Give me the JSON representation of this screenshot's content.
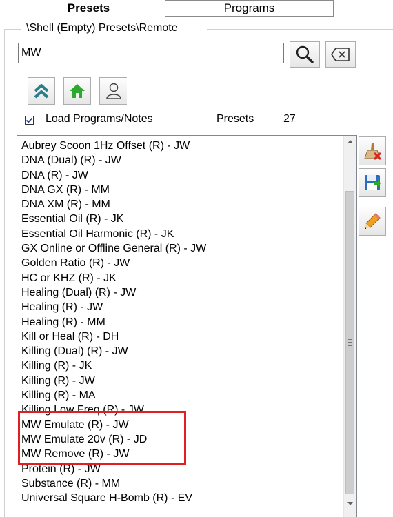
{
  "tabs": [
    {
      "label": "Presets",
      "active": true
    },
    {
      "label": "Programs",
      "active": false
    }
  ],
  "path": "\\Shell (Empty) Presets\\Remote",
  "search": {
    "value": "MW",
    "placeholder": ""
  },
  "icons": {
    "search": "search-icon",
    "clear": "backspace-clear-icon",
    "up": "double-chevron-up-icon",
    "home": "home-icon",
    "user": "user-icon",
    "erase": "eraser-icon",
    "save": "save-floppy-icon",
    "edit": "pencil-icon"
  },
  "options": {
    "load_programs_label": "Load Programs/Notes",
    "load_programs_checked": true,
    "presets_label": "Presets",
    "presets_count": "27"
  },
  "list": [
    "Aubrey Scoon 1Hz Offset (R) - JW",
    "DNA (Dual) (R) - JW",
    "DNA (R) - JW",
    "DNA GX (R) - MM",
    "DNA XM (R) - MM",
    "Essential Oil (R) - JK",
    "Essential Oil Harmonic (R) - JK",
    "GX Online or Offline General (R) - JW",
    "Golden Ratio (R) - JW",
    "HC or KHZ (R) - JK",
    "Healing (Dual) (R) - JW",
    "Healing (R) - JW",
    "Healing (R) - MM",
    "Kill or Heal (R) - DH",
    "Killing (Dual) (R) - JW",
    "Killing (R) - JK",
    "Killing (R) - JW",
    "Killing (R) - MA",
    "Killing Low Freq (R) - JW",
    "MW Emulate (R) - JW",
    "MW Emulate 20v (R) - JD",
    "MW Remove (R) - JW",
    "Protein (R) - JW",
    "Substance (R) - MM",
    "Universal Square H-Bomb (R) - EV"
  ],
  "colors": {
    "highlight": "#e02020",
    "home_green": "#2fa82f",
    "up_teal": "#2a7f8a"
  }
}
